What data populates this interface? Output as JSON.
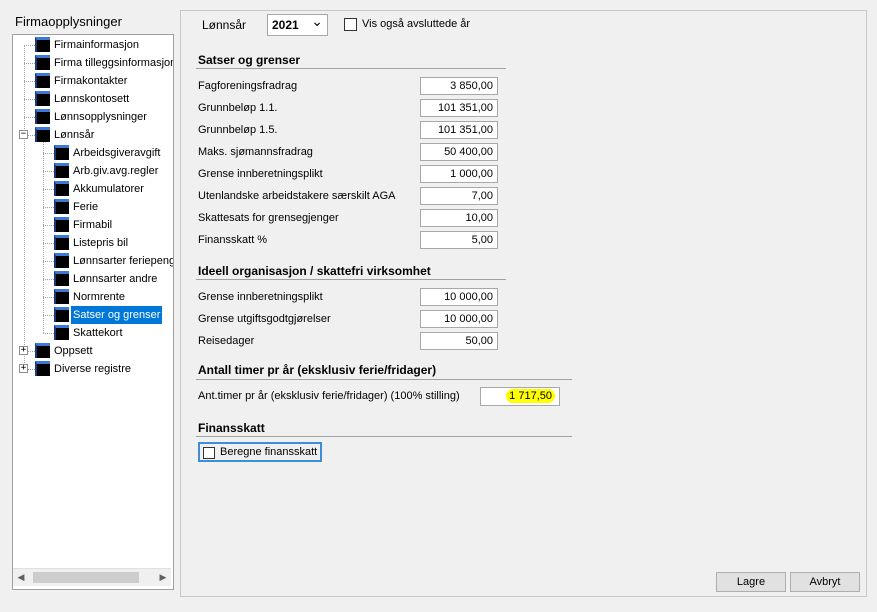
{
  "left_panel": {
    "title": "Firmaopplysninger",
    "tree": [
      {
        "label": "Firmainformasjon",
        "level": 1
      },
      {
        "label": "Firma tilleggsinformasjon",
        "level": 1
      },
      {
        "label": "Firmakontakter",
        "level": 1
      },
      {
        "label": "Lønnskontosett",
        "level": 1
      },
      {
        "label": "Lønnsopplysninger",
        "level": 1
      },
      {
        "label": "Lønnsår",
        "level": 1,
        "expander": "−"
      },
      {
        "label": "Arbeidsgiveravgift",
        "level": 2
      },
      {
        "label": "Arb.giv.avg.regler",
        "level": 2
      },
      {
        "label": "Akkumulatorer",
        "level": 2
      },
      {
        "label": "Ferie",
        "level": 2
      },
      {
        "label": "Firmabil",
        "level": 2
      },
      {
        "label": "Listepris bil",
        "level": 2
      },
      {
        "label": "Lønnsarter feriepenger",
        "level": 2
      },
      {
        "label": "Lønnsarter andre",
        "level": 2
      },
      {
        "label": "Normrente",
        "level": 2
      },
      {
        "label": "Satser og grenser",
        "level": 2,
        "selected": true
      },
      {
        "label": "Skattekort",
        "level": 2
      },
      {
        "label": "Oppsett",
        "level": 1,
        "expander": "+"
      },
      {
        "label": "Diverse registre",
        "level": 1,
        "expander": "+"
      }
    ],
    "scroll_left_icon": "◀",
    "scroll_right_icon": "▶"
  },
  "header": {
    "year_label": "Lønnsår",
    "year_value": "2021",
    "dropdown_icon": "chevron-down-icon",
    "dropdown_glyph": "⌄",
    "show_closed_label": "Vis også avsluttede år"
  },
  "sections": {
    "rates": {
      "title": "Satser og grenser",
      "rows": [
        {
          "label": "Fagforeningsfradrag",
          "value": "3 850,00"
        },
        {
          "label": "Grunnbeløp 1.1.",
          "value": "101 351,00"
        },
        {
          "label": "Grunnbeløp 1.5.",
          "value": "101 351,00"
        },
        {
          "label": "Maks. sjømannsfradrag",
          "value": "50 400,00"
        },
        {
          "label": "Grense innberetningsplikt",
          "value": "1 000,00"
        },
        {
          "label": "Utenlandske arbeidstakere særskilt AGA",
          "value": "7,00"
        },
        {
          "label": "Skattesats for grensegjenger",
          "value": "10,00"
        },
        {
          "label": "Finansskatt %",
          "value": "5,00"
        }
      ]
    },
    "ideal": {
      "title": "Ideell organisasjon / skattefri virksomhet",
      "rows": [
        {
          "label": "Grense innberetningsplikt",
          "value": "10 000,00"
        },
        {
          "label": "Grense utgiftsgodtgjørelser",
          "value": "10 000,00"
        },
        {
          "label": "Reisedager",
          "value": "50,00"
        }
      ]
    },
    "hours": {
      "title": "Antall timer pr år (eksklusiv ferie/fridager)",
      "label": "Ant.timer pr år (eksklusiv ferie/fridager) (100% stilling)",
      "value": "1 717,50"
    },
    "finance": {
      "title": "Finansskatt",
      "checkbox_label": "Beregne finansskatt"
    }
  },
  "buttons": {
    "save": "Lagre",
    "cancel": "Avbryt"
  },
  "colors": {
    "selection": "#0078d7",
    "highlight": "#ffff00",
    "focus_border": "#3c8fd6"
  }
}
